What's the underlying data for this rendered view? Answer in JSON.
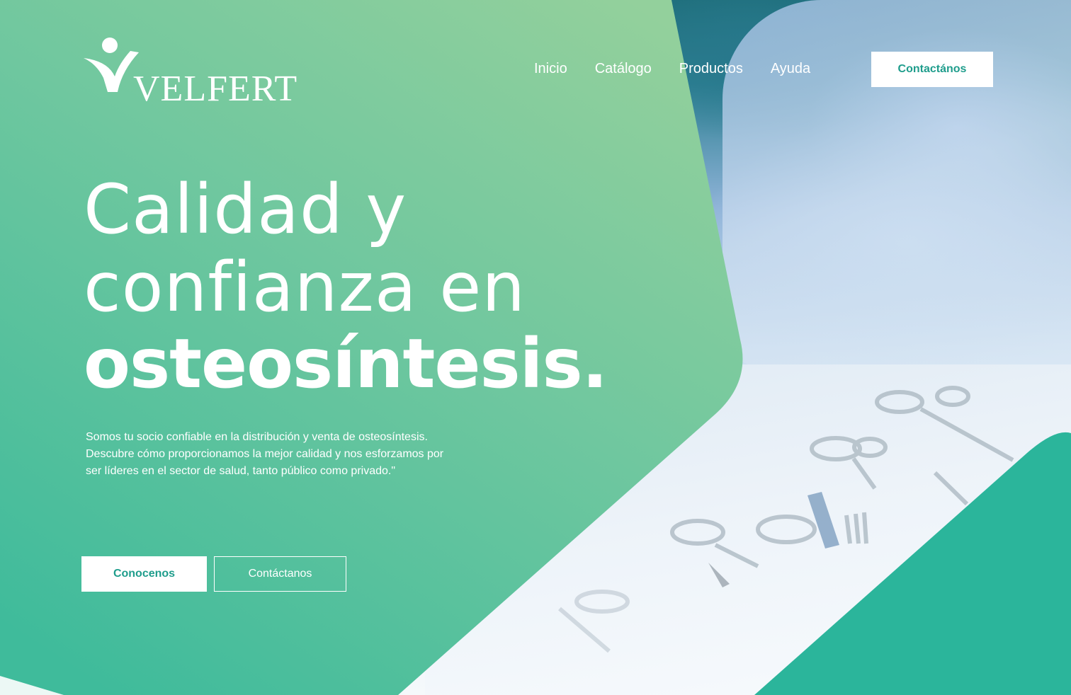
{
  "brand": {
    "name": "VELFERT",
    "colors": {
      "primary": "#2bb59b",
      "light_green": "#8ecf9c",
      "white": "#ffffff",
      "button_text": "#1f9d8c"
    }
  },
  "nav": {
    "items": [
      {
        "label": "Inicio"
      },
      {
        "label": "Catálogo"
      },
      {
        "label": "Productos"
      },
      {
        "label": "Ayuda"
      }
    ],
    "contact_label": "Contactános"
  },
  "hero": {
    "line1": "Calidad y",
    "line2": "confianza en",
    "line3": "osteosíntesis.",
    "description": [
      "Somos tu socio confiable en la distribución y venta de osteosíntesis.",
      "Descubre cómo proporcionamos la mejor calidad y nos esforzamos por",
      "ser líderes en el sector de salud, tanto público como privado.\""
    ],
    "primary_button": "Conocenos",
    "secondary_button": "Contáctanos"
  },
  "background": {
    "image": "surgical-instruments-photo"
  }
}
